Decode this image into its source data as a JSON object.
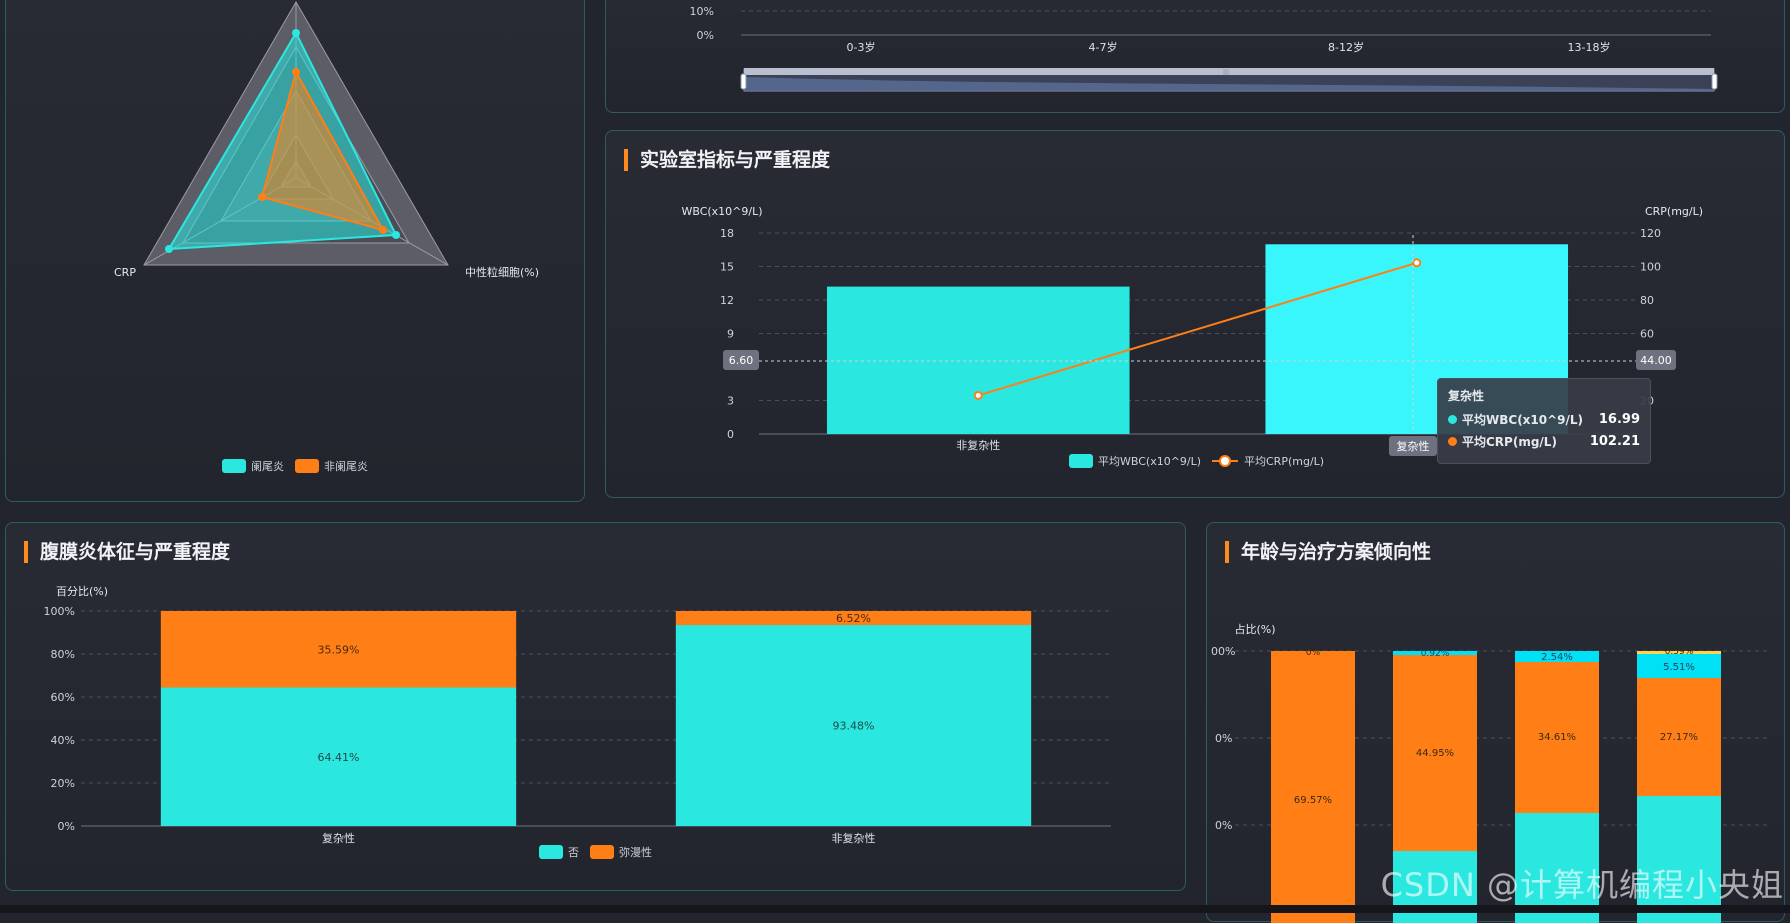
{
  "colors": {
    "cyan": "#2ae8e0",
    "cyan_bright": "#38f6fb",
    "orange": "#ff7f16",
    "accent_bar": "#ff8a1f",
    "panel_border": "#2e5c60"
  },
  "radar": {
    "indicators": [
      "CRP",
      "中性粒细胞(%)"
    ],
    "legend": [
      "阑尾炎",
      "非阑尾炎"
    ]
  },
  "age_panel": {
    "y_ticks": [
      "10%",
      "0%"
    ],
    "categories": [
      "0-3岁",
      "4-7岁",
      "8-12岁",
      "13-18岁"
    ],
    "slider_handle": "|||"
  },
  "lab_panel": {
    "title": "实验室指标与严重程度",
    "y_left_label": "WBC(x10^9/L)",
    "y_right_label": "CRP(mg/L)",
    "y_left_ticks": [
      "0",
      "3",
      "9",
      "12",
      "15",
      "18"
    ],
    "y_right_ticks": [
      "20",
      "60",
      "80",
      "100",
      "120"
    ],
    "pointer_left": "6.60",
    "pointer_right": "44.00",
    "axis_pointer_label": "复杂性",
    "tooltip": {
      "title": "复杂性",
      "rows": [
        {
          "label": "平均WBC(x10^9/L)",
          "value": "16.99"
        },
        {
          "label": "平均CRP(mg/L)",
          "value": "102.21"
        }
      ]
    },
    "legend": [
      "平均WBC(x10^9/L)",
      "平均CRP(mg/L)"
    ]
  },
  "peritonitis_panel": {
    "title": "腹膜炎体征与严重程度",
    "y_label": "百分比(%)",
    "y_ticks": [
      "0%",
      "20%",
      "40%",
      "60%",
      "80%",
      "100%"
    ],
    "legend": [
      "否",
      "弥漫性"
    ]
  },
  "treatment_panel": {
    "title": "年龄与治疗方案倾向性",
    "y_label": "占比(%)",
    "y_ticks": [
      "00%",
      "0%",
      "0%"
    ]
  },
  "chart_data": [
    {
      "type": "radar",
      "indicators": [
        "CRP",
        "中性粒细胞(%)"
      ],
      "series": [
        {
          "name": "阑尾炎"
        },
        {
          "name": "非阑尾炎"
        }
      ],
      "legend_position": "bottom"
    },
    {
      "type": "bar",
      "categories": [
        "0-3岁",
        "4-7岁",
        "8-12岁",
        "13-18岁"
      ],
      "y_ticks_visible": [
        "10%",
        "0%"
      ],
      "has_data_zoom_slider": true
    },
    {
      "type": "bar+line",
      "title": "实验室指标与严重程度",
      "categories": [
        "非复杂性",
        "复杂性"
      ],
      "series": [
        {
          "name": "平均WBC(x10^9/L)",
          "type": "bar",
          "axis": "left",
          "values": [
            13.2,
            16.99
          ]
        },
        {
          "name": "平均CRP(mg/L)",
          "type": "line",
          "axis": "right",
          "values": [
            23,
            102.21
          ]
        }
      ],
      "ylabel_left": "WBC(x10^9/L)",
      "ylabel_right": "CRP(mg/L)",
      "ylim_left": [
        0,
        18
      ],
      "ylim_right": [
        0,
        120
      ],
      "grid": true,
      "legend_position": "bottom"
    },
    {
      "type": "bar",
      "stacked": true,
      "title": "腹膜炎体征与严重程度",
      "ylabel": "百分比(%)",
      "categories": [
        "复杂性",
        "非复杂性"
      ],
      "series": [
        {
          "name": "否",
          "values": [
            64.41,
            93.48
          ],
          "labels": [
            "64.41%",
            "93.48%"
          ]
        },
        {
          "name": "弥漫性",
          "values": [
            35.59,
            6.52
          ],
          "labels": [
            "35.59%",
            "6.52%"
          ]
        }
      ],
      "ylim": [
        0,
        100
      ],
      "grid": true,
      "legend_position": "bottom"
    },
    {
      "type": "bar",
      "stacked": true,
      "title": "年龄与治疗方案倾向性",
      "ylabel": "占比(%)",
      "visible_segments": [
        {
          "bar": 1,
          "labels": [
            "69.57%",
            "0%"
          ]
        },
        {
          "bar": 2,
          "labels": [
            "44.95%",
            "0.92%"
          ]
        },
        {
          "bar": 3,
          "labels": [
            "34.61%",
            "2.54%"
          ]
        },
        {
          "bar": 4,
          "labels": [
            "27.17%",
            "5.51%",
            "0.59%"
          ]
        }
      ],
      "grid": true
    }
  ],
  "watermark": "CSDN @计算机编程小央姐"
}
